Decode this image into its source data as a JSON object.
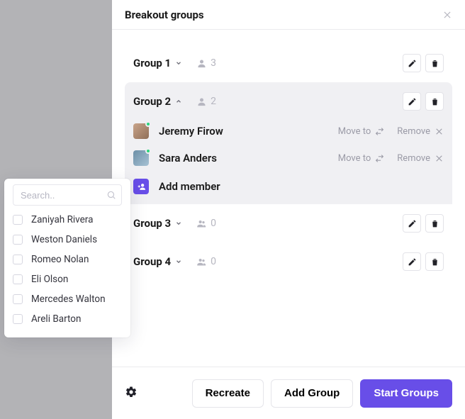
{
  "header": {
    "title": "Breakout groups"
  },
  "groups": [
    {
      "name": "Group 1",
      "count": "3"
    },
    {
      "name": "Group 2",
      "count": "2"
    },
    {
      "name": "Group 3",
      "count": "0"
    },
    {
      "name": "Group 4",
      "count": "0"
    }
  ],
  "members": [
    {
      "name": "Jeremy Firow",
      "move_label": "Move to",
      "remove_label": "Remove"
    },
    {
      "name": "Sara Anders",
      "move_label": "Move to",
      "remove_label": "Remove"
    }
  ],
  "add_member_label": "Add member",
  "footer": {
    "recreate_label": "Recreate",
    "add_group_label": "Add Group",
    "start_label": "Start Groups"
  },
  "popover": {
    "search_placeholder": "Search..",
    "options": [
      "Zaniyah Rivera",
      "Weston Daniels",
      "Romeo Nolan",
      "Eli Olson",
      "Mercedes Walton",
      "Areli Barton"
    ]
  }
}
